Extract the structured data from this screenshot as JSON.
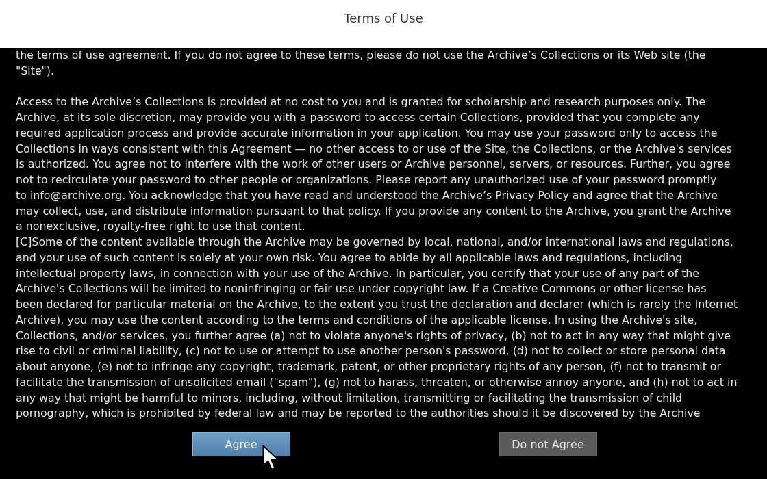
{
  "dialog": {
    "title": "Terms of Use"
  },
  "terms": {
    "paragraphs": [
      {
        "lines": [
          "the terms of use agreement. If you do not agree to these terms, please do not use the Archive’s Collections or its Web site (the",
          "\"Site\")."
        ]
      },
      {
        "lines": [
          "Access to the Archive’s Collections is provided at no cost to you and is granted for scholarship and research purposes only. The",
          "Archive, at its sole discretion, may provide you with a password to access certain Collections, provided that you complete any",
          "required application process and provide accurate information in your application. You may use your password only to access the",
          "Collections in ways consistent with this Agreement — no other access to or use of the Site, the Collections, or the Archive's services",
          "is authorized. You agree not to interfere with the work of other users or Archive personnel, servers, or resources. Further, you agree",
          "not to recirculate your password to other people or organizations. Please report any unauthorized use of your password promptly",
          "to info@archive.org. You acknowledge that you have read and understood the Archive’s Privacy Policy and agree that the Archive",
          "may collect, use, and distribute information pursuant to that policy. If you provide any content to the Archive, you grant the Archive",
          "a nonexclusive, royalty-free right to use that content.",
          "[C]Some of the content available through the Archive may be governed by local, national, and/or international laws and regulations,",
          "and your use of such content is solely at your own risk. You agree to abide by all applicable laws and regulations, including",
          "intellectual property laws, in connection with your use of the Archive. In particular, you certify that your use of any part of the",
          "Archive's Collections will be limited to noninfringing or fair use under copyright law. If a Creative Commons or other license has",
          "been declared for particular material on the Archive, to the extent you trust the declaration and declarer (which is rarely the Internet",
          "Archive), you may use the content according to the terms and conditions of the applicable license. In using the Archive's site,",
          "Collections, and/or services, you further agree (a) not to violate anyone's rights of privacy, (b) not to act in any way that might give",
          "rise to civil or criminal liability, (c) not to use or attempt to use another person's password, (d) not to collect or store personal data",
          "about anyone, (e) not to infringe any copyright, trademark, patent, or other proprietary rights of any person, (f) not to transmit or",
          "facilitate the transmission of unsolicited email (\"spam\"), (g) not to harass, threaten, or otherwise annoy anyone, and (h) not to act in",
          "any way that might be harmful to minors, including, without limitation, transmitting or facilitating the transmission of child",
          "pornography, which is prohibited by federal law and may be reported to the authorities should it be discovered by the Archive"
        ]
      }
    ]
  },
  "buttons": [
    {
      "label": "Agree",
      "selected": true
    },
    {
      "label": "Do not Agree",
      "selected": false
    }
  ]
}
